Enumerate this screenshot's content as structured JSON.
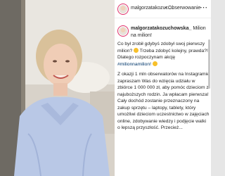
{
  "post": {
    "header": {
      "username": "malgorzatakozuc…",
      "separator": "•",
      "follow_label": "Obserwowanie",
      "more_icon": "more-horizontal-icon"
    },
    "caption": {
      "username": "malgorzatakozuchowska_",
      "title_text": "Milion na milion!",
      "line_1": "Co był zrobił gdybyś zdobył swoj pierwszy milion?",
      "line_2": "Trzeba zdobyć kolejny, prawda?! Dlatego rozpoczynam akcję",
      "hashtag": "#milionnamilion!",
      "line_3": "Z okazji 1 mln obserwatorów na Instagramie zapraszam Was do wzięcia udziału w zbiórce 1 000 000 zł, aby pomóc dzieciom z najuboższych rodzin. Ja wpłacam pierwsza! Cały dochód zostanie przeznaczony na zakup sprzętu – laptopy, tablety, który umożliwi dzieciom uczestnictwo w zajęciach online, zdobywanie wiedzy i podjęcie walki o lepszą przyszłość.",
      "ellipsis": "Przecież..."
    }
  },
  "colors": {
    "link": "#00376b",
    "avatar_ring": "#e1306c",
    "text": "#262626"
  }
}
